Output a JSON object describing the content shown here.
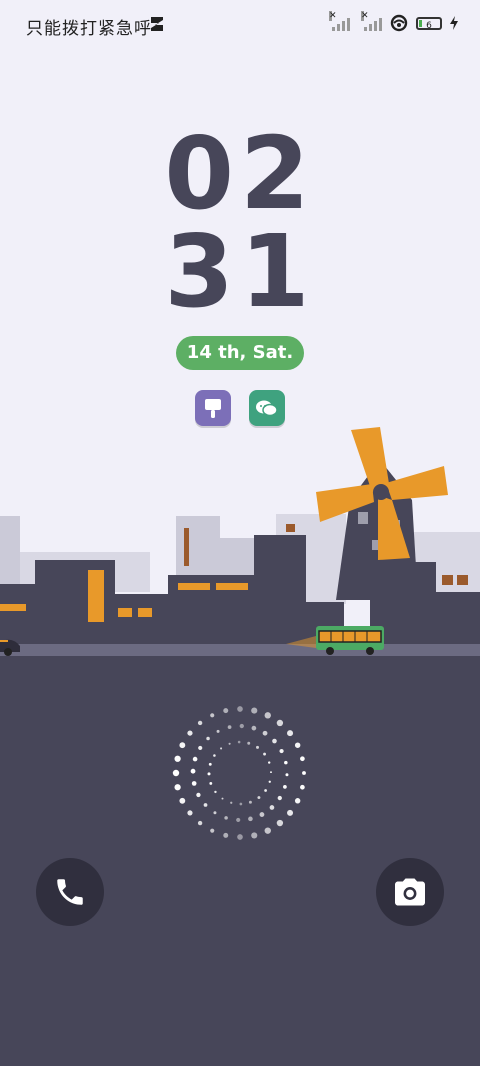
{
  "status_bar": {
    "carrier_text": "只能拨打紧急呼",
    "battery_level": "6",
    "icons": [
      "sim-card-icon",
      "signal-1-icon",
      "signal-2-icon",
      "hotspot-icon",
      "battery-icon",
      "charging-icon"
    ]
  },
  "clock": {
    "hours": "02",
    "minutes": "31"
  },
  "date": {
    "label": "14 th, Sat."
  },
  "shortcuts": [
    {
      "icon": "brush-icon"
    },
    {
      "icon": "chat-icon"
    }
  ],
  "colors": {
    "background": "#f1f0f9",
    "ground": "#474659",
    "accent_green": "#5daf64",
    "windmill_orange": "#e8992a"
  },
  "actions": {
    "left": "phone-icon",
    "right": "camera-icon"
  }
}
